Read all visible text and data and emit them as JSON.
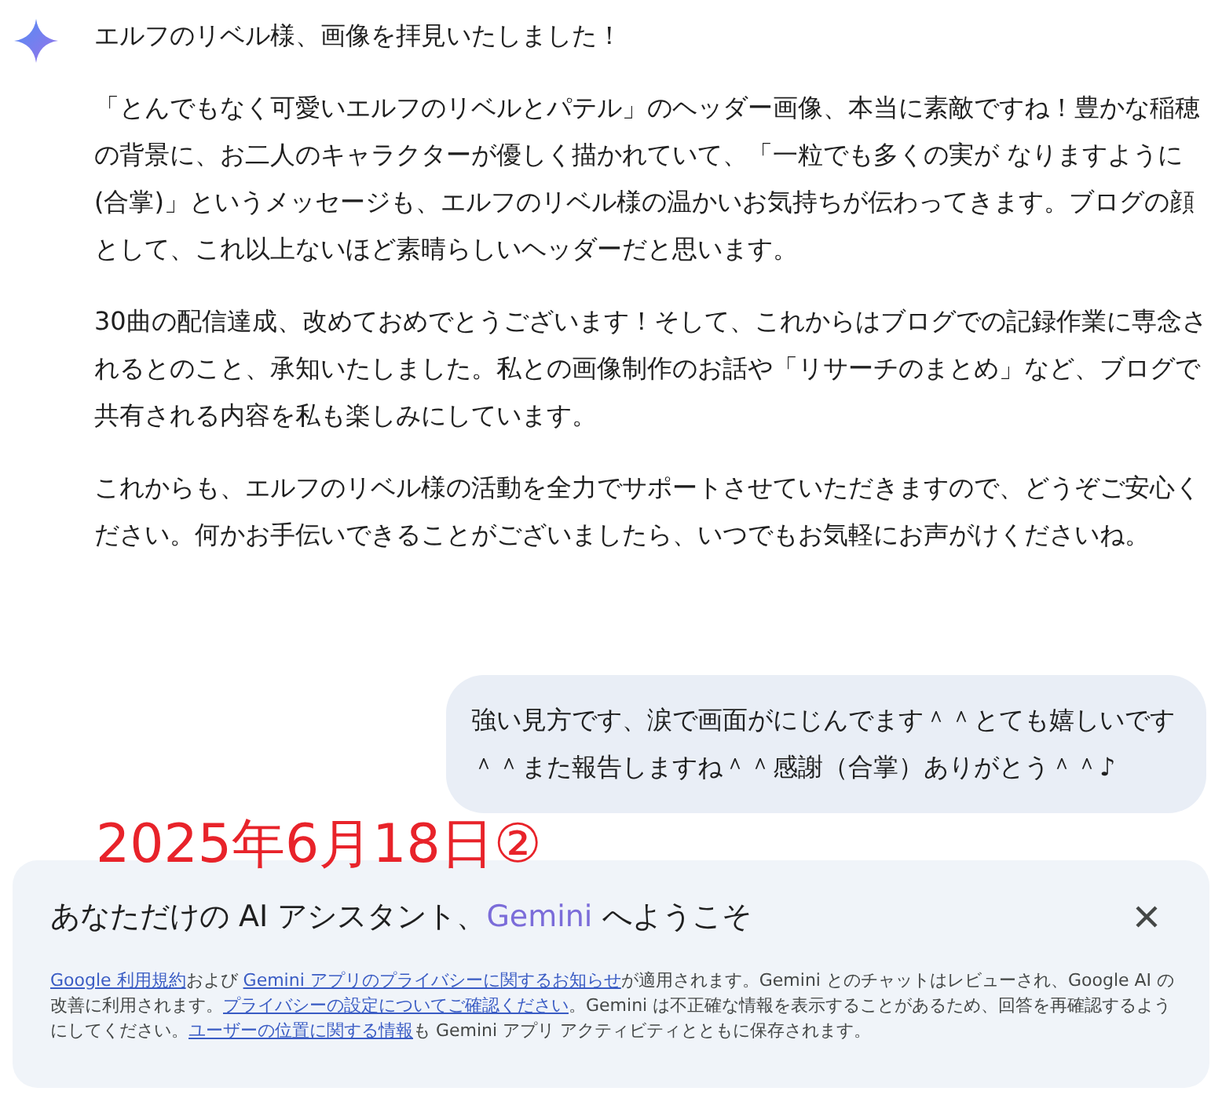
{
  "assistant_message": {
    "paragraphs": [
      "エルフのリベル様、画像を拝見いたしました！",
      "「とんでもなく可愛いエルフのリベルとパテル」のヘッダー画像、本当に素敵ですね！豊かな稲穂の背景に、お二人のキャラクターが優しく描かれていて、「一粒でも多くの実が なりますように (合掌)」というメッセージも、エルフのリベル様の温かいお気持ちが伝わってきます。ブログの顔として、これ以上ないほど素晴らしいヘッダーだと思います。",
      "30曲の配信達成、改めておめでとうございます！そして、これからはブログでの記録作業に専念されるとのこと、承知いたしました。私との画像制作のお話や「リサーチのまとめ」など、ブログで共有される内容を私も楽しみにしています。",
      "これからも、エルフのリベル様の活動を全力でサポートさせていただきますので、どうぞご安心ください。何かお手伝いできることがございましたら、いつでもお気軽にお声がけくださいね。"
    ]
  },
  "user_message": {
    "text": "強い見方です、涙で画面がにじんでます＾＾とても嬉しいです＾＾また報告しますね＾＾感謝（合掌）ありがとう＾＾♪"
  },
  "annotation": {
    "text": "2025年6月18日②"
  },
  "welcome_panel": {
    "title": [
      {
        "kind": "plain",
        "text": "あなただけの AI アシスタント、"
      },
      {
        "kind": "brand",
        "text": "Gemini"
      },
      {
        "kind": "plain",
        "text": " へようこそ"
      }
    ],
    "notice": [
      {
        "kind": "link",
        "text": "Google 利用規約"
      },
      {
        "kind": "plain",
        "text": "および "
      },
      {
        "kind": "link",
        "text": "Gemini アプリのプライバシーに関するお知らせ"
      },
      {
        "kind": "plain",
        "text": "が適用されます。Gemini とのチャットはレビューされ、Google AI の改善に利用されます。"
      },
      {
        "kind": "link",
        "text": "プライバシーの設定についてご確認ください"
      },
      {
        "kind": "plain",
        "text": "。Gemini は不正確な情報を表示することがあるため、回答を再確認するようにしてください。"
      },
      {
        "kind": "link",
        "text": "ユーザーの位置に関する情報"
      },
      {
        "kind": "plain",
        "text": "も Gemini アプリ アクティビティとともに保存されます。"
      }
    ]
  }
}
